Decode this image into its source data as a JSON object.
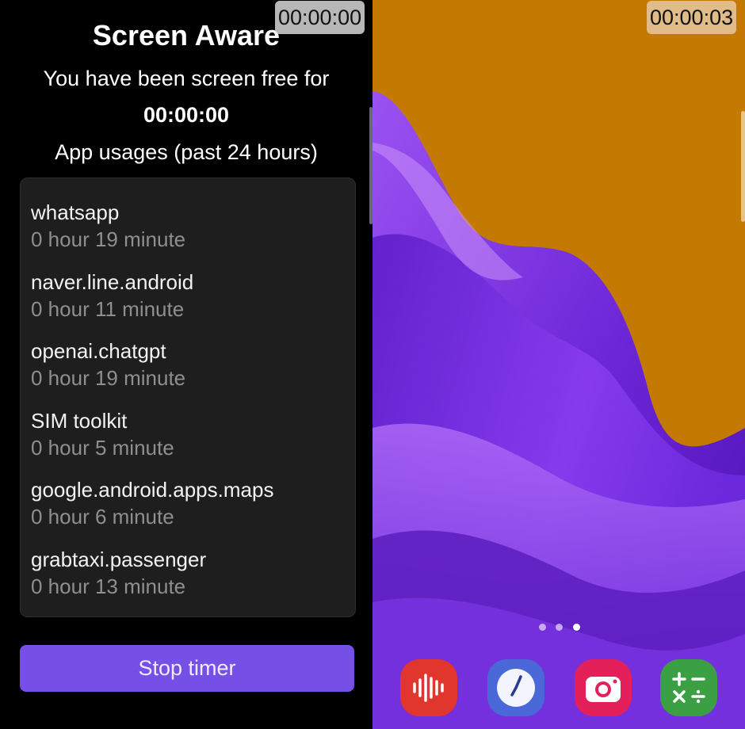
{
  "app": {
    "title": "Screen Aware",
    "subtitle": "You have been screen free for",
    "timer": "00:00:00",
    "usage_heading": "App usages (past 24 hours)",
    "usage_items": [
      {
        "name": "whatsapp",
        "time": "0 hour 19 minute"
      },
      {
        "name": "naver.line.android",
        "time": "0 hour 11 minute"
      },
      {
        "name": "openai.chatgpt",
        "time": "0 hour 19 minute"
      },
      {
        "name": "SIM toolkit",
        "time": "0 hour 5 minute"
      },
      {
        "name": "google.android.apps.maps",
        "time": "0 hour 6 minute"
      },
      {
        "name": "grabtaxi.passenger",
        "time": "0 hour 13 minute"
      }
    ],
    "stop_button_label": "Stop timer",
    "colors": {
      "accent": "#7650e6",
      "card_background": "#1e1e1e",
      "secondary_text": "#8f8f8f"
    }
  },
  "overlays": {
    "left_clock": "00:00:00",
    "right_clock": "00:00:03"
  },
  "home_screen": {
    "page_count": 3,
    "active_page": 3,
    "dock_apps": [
      {
        "icon": "voice-recorder-icon",
        "color": "#e0362e"
      },
      {
        "icon": "clock-icon",
        "color": "#4a68d8"
      },
      {
        "icon": "camera-icon",
        "color": "#e4205a"
      },
      {
        "icon": "calculator-icon",
        "color": "#3aa043"
      }
    ],
    "wallpaper_colors": {
      "background": "#c47a02",
      "wave": "#7a2ee0"
    }
  }
}
